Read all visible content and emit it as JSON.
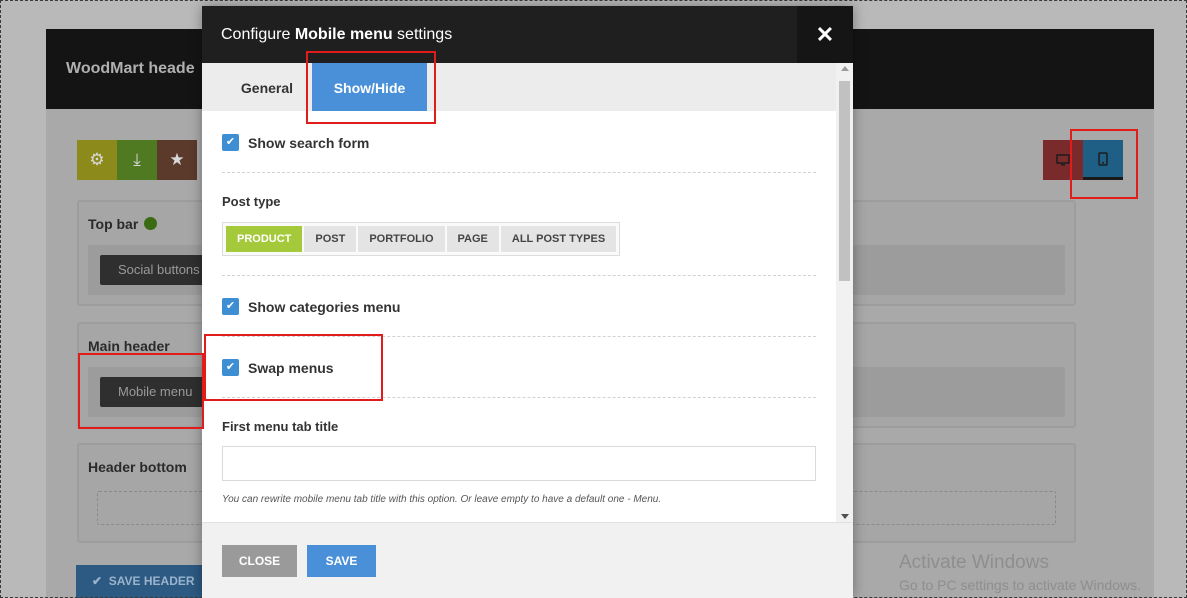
{
  "background": {
    "header_title": "WoodMart heade",
    "toolbar": [
      {
        "name": "settings",
        "icon": "gear-icon",
        "glyph": "⚙"
      },
      {
        "name": "import",
        "icon": "download-icon",
        "glyph": "⤓"
      },
      {
        "name": "favorites",
        "icon": "star-icon",
        "glyph": "★"
      }
    ],
    "sections": {
      "top_bar": {
        "label": "Top bar",
        "chip": "Social buttons"
      },
      "main_header": {
        "label": "Main header",
        "chip": "Mobile menu"
      },
      "header_bottom": {
        "label": "Header bottom"
      }
    },
    "save_header_label": "SAVE HEADER",
    "save_header_icon": "✔",
    "watermark": {
      "line1": "Activate Windows",
      "line2": "Go to PC settings to activate Windows."
    }
  },
  "modal": {
    "title_prefix": "Configure ",
    "title_bold": "Mobile menu",
    "title_suffix": " settings",
    "close_glyph": "✕",
    "tabs": [
      {
        "label": "General",
        "active": false
      },
      {
        "label": "Show/Hide",
        "active": true
      }
    ],
    "fields": {
      "show_search_form": {
        "label": "Show search form",
        "checked": true
      },
      "post_type": {
        "label": "Post type",
        "options": [
          "PRODUCT",
          "POST",
          "PORTFOLIO",
          "PAGE",
          "ALL POST TYPES"
        ],
        "selected": "PRODUCT"
      },
      "show_categories_menu": {
        "label": "Show categories menu",
        "checked": true
      },
      "swap_menus": {
        "label": "Swap menus",
        "checked": true
      },
      "first_menu_tab_title": {
        "label": "First menu tab title",
        "value": "",
        "hint": "You can rewrite mobile menu tab title with this option. Or leave empty to have a default one - Menu."
      }
    },
    "footer": {
      "close_label": "CLOSE",
      "save_label": "SAVE"
    }
  },
  "colors": {
    "accent_blue": "#4a90d9",
    "selected_green": "#a4c93a",
    "highlight_red": "#e21b1b"
  }
}
